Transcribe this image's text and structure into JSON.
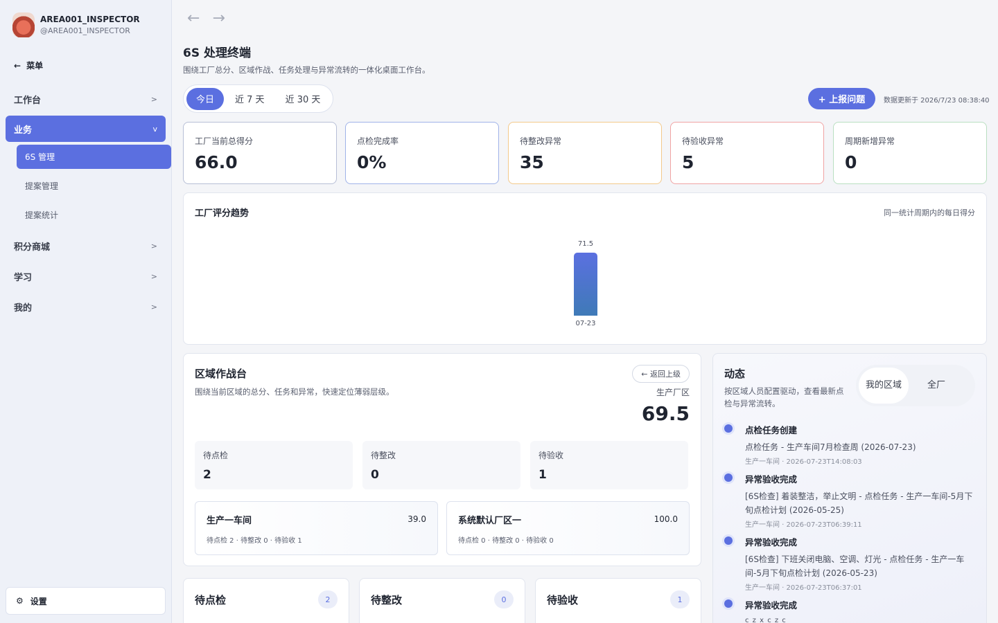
{
  "sidebar": {
    "user_name": "AREA001_INSPECTOR",
    "user_handle": "@AREA001_INSPECTOR",
    "menu_back": "菜单",
    "items": [
      {
        "label": "工作台"
      },
      {
        "label": "业务"
      },
      {
        "label": "积分商城"
      },
      {
        "label": "学习"
      },
      {
        "label": "我的"
      }
    ],
    "sub_items": [
      {
        "label": "6S 管理"
      },
      {
        "label": "提案管理"
      },
      {
        "label": "提案统计"
      }
    ],
    "settings": "设置"
  },
  "header": {
    "title": "6S 处理终端",
    "subtitle": "围绕工厂总分、区域作战、任务处理与异常流转的一体化桌面工作台。",
    "range_tabs": [
      "今日",
      "近 7 天",
      "近 30 天"
    ],
    "report_button": "+ 上报问题",
    "updated": "数据更新于 2026/7/23 08:38:40"
  },
  "kpis": [
    {
      "label": "工厂当前总得分",
      "value": "66.0",
      "color": "#b7bfd6"
    },
    {
      "label": "点检完成率",
      "value": "0%",
      "color": "#9fb2e8"
    },
    {
      "label": "待整改异常",
      "value": "35",
      "color": "#f3c98a"
    },
    {
      "label": "待验收异常",
      "value": "5",
      "color": "#f0a3a3"
    },
    {
      "label": "周期新增异常",
      "value": "0",
      "color": "#b9dfc1"
    }
  ],
  "trend": {
    "title": "工厂评分趋势",
    "note": "同一统计周期内的每日得分"
  },
  "chart_data": {
    "type": "bar",
    "categories": [
      "07-23"
    ],
    "values": [
      71.5
    ],
    "ylim": [
      0,
      75
    ]
  },
  "zone": {
    "title": "区域作战台",
    "desc": "围绕当前区域的总分、任务和异常，快速定位薄弱层级。",
    "back": "← 返回上级",
    "area_name": "生产厂区",
    "score": "69.5",
    "stats": [
      {
        "label": "待点检",
        "value": "2"
      },
      {
        "label": "待整改",
        "value": "0"
      },
      {
        "label": "待验收",
        "value": "1"
      }
    ],
    "sub_areas": [
      {
        "name": "生产一车间",
        "score": "39.0",
        "meta": "待点检 2 · 待整改 0 · 待验收 1"
      },
      {
        "name": "系统默认厂区一",
        "score": "100.0",
        "meta": "待点检 0 · 待整改 0 · 待验收 0"
      }
    ]
  },
  "activity": {
    "title": "动态",
    "desc": "按区域人员配置驱动，查看最新点检与异常流转。",
    "tabs": [
      "我的区域",
      "全厂"
    ],
    "items": [
      {
        "head": "点检任务创建",
        "body": "点检任务 - 生产车间7月检查周 (2026-07-23)",
        "meta": "生产一车间 · 2026-07-23T14:08:03"
      },
      {
        "head": "异常验收完成",
        "body": "[6S检查] 着装整洁，举止文明 - 点检任务 - 生产一车间-5月下旬点检计划 (2026-05-25)",
        "meta": "生产一车间 · 2026-07-23T06:39:11"
      },
      {
        "head": "异常验收完成",
        "body": "[6S检查] 下班关闭电脑、空调、灯光 - 点检任务 - 生产一车间-5月下旬点检计划 (2026-05-23)",
        "meta": "生产一车间 · 2026-07-23T06:37:01"
      },
      {
        "head": "异常验收完成",
        "body": "c z x c z c",
        "meta": ""
      }
    ]
  },
  "queues": [
    {
      "title": "待点检",
      "count": "2"
    },
    {
      "title": "待整改",
      "count": "0"
    },
    {
      "title": "待验收",
      "count": "1"
    }
  ]
}
